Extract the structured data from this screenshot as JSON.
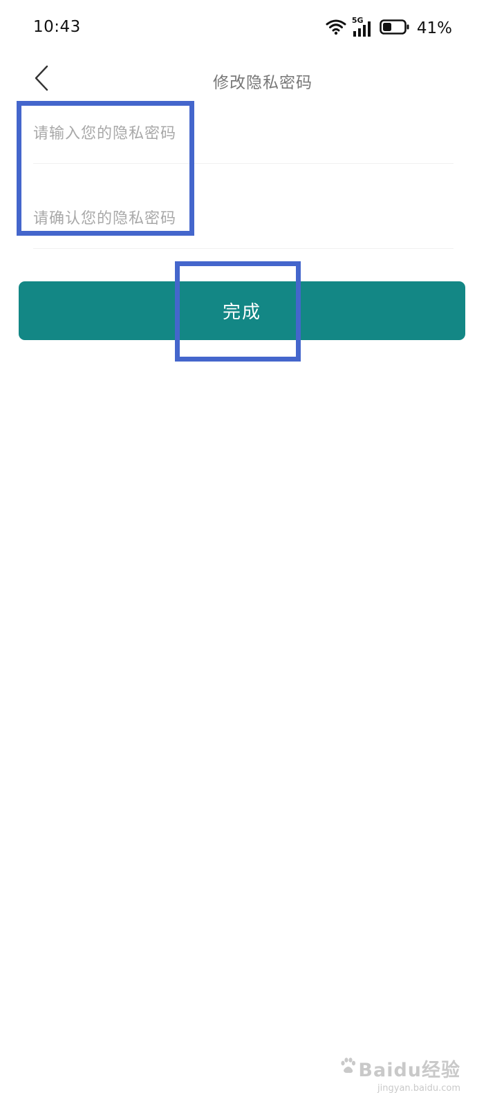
{
  "status_bar": {
    "time": "10:43",
    "network": "5G",
    "battery_percent": "41%",
    "battery_level": 0.41
  },
  "header": {
    "title": "修改隐私密码"
  },
  "form": {
    "password_placeholder": "请输入您的隐私密码",
    "confirm_placeholder": "请确认您的隐私密码",
    "password_value": "",
    "confirm_value": ""
  },
  "actions": {
    "done_label": "完成"
  },
  "watermark": {
    "brand": "Baidu经验",
    "url": "jingyan.baidu.com"
  },
  "colors": {
    "accent": "#138785",
    "annotation": "#4466cc"
  },
  "icons": {
    "back": "chevron-left-icon",
    "wifi": "wifi-icon",
    "signal": "signal-icon",
    "battery": "battery-icon",
    "paw": "paw-icon"
  }
}
